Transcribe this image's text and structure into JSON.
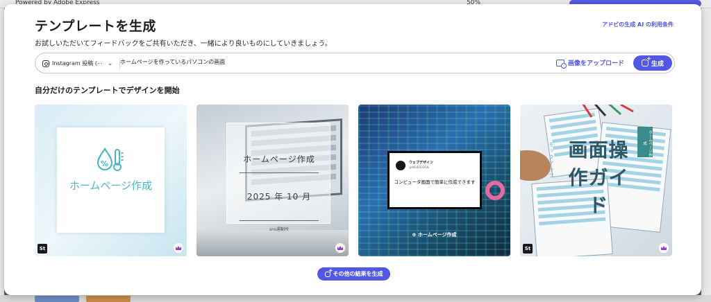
{
  "background": {
    "tab_title": "Powered by Adobe Express",
    "zoom": "50%"
  },
  "modal": {
    "title": "テンプレートを生成",
    "terms_link": "アドビの生成 AI の利用条件",
    "subtitle": "お試しいただいてフィードバックをご共有いただき、一緒により良いものにしていきましょう。"
  },
  "prompt": {
    "format_label": "Instagram 投稿 (⋯",
    "text": "ホームページを作っているパソコンの画面",
    "upload_label": "画像をアップロード",
    "generate_label": "生成"
  },
  "section_title": "自分だけのテンプレートでデザインを開始",
  "cards": [
    {
      "badge": "St",
      "text": "ホームページ作成"
    },
    {
      "title": "ホームページ作成",
      "date": "2025 年 10 月",
      "footer": "sns運動所"
    },
    {
      "name": "ウェブデザイン",
      "handle": "@WEBDESIGN",
      "message": "コンピュータ画面で簡単に作成できます",
      "footer": "ホームページ作成"
    },
    {
      "badge": "St",
      "big_text": "画面操作ガイド",
      "tag": "ホームページ作成",
      "vertical": "モックアップ"
    }
  ],
  "more_button": "その他の結果を生成",
  "colors": {
    "accent": "#5258e4",
    "link": "#4f55e0",
    "teal": "#4bb6c8",
    "premium": "#9b3fd3"
  }
}
